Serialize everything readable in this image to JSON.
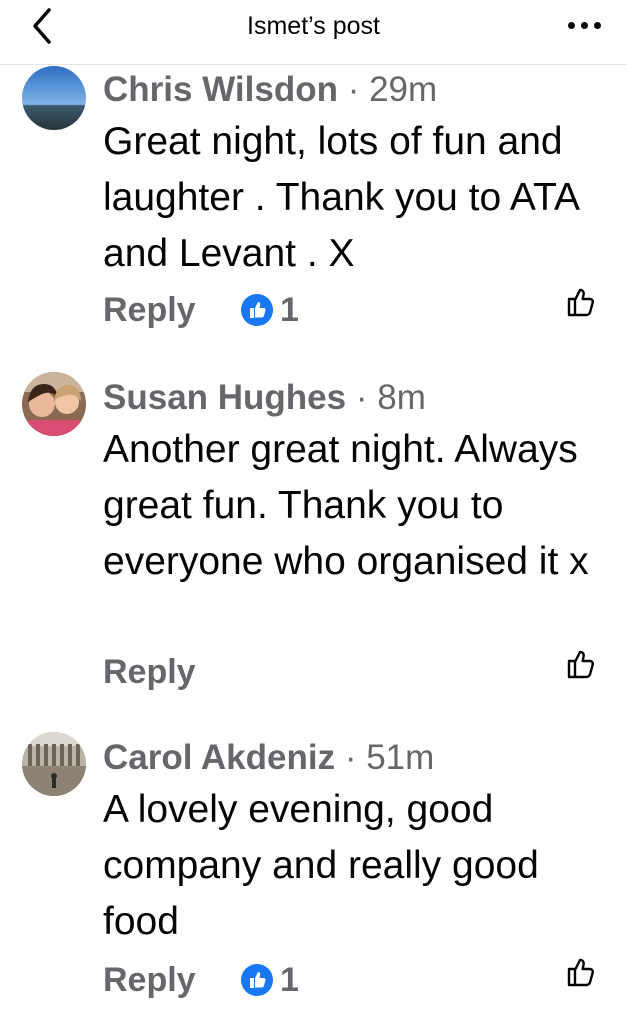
{
  "header": {
    "title": "Ismet’s post",
    "back_icon": "chevron-left-icon",
    "more_icon": "more-dots-icon"
  },
  "colors": {
    "text_primary": "#050505",
    "text_secondary": "#65676b",
    "like_blue": "#1877f2",
    "divider": "#e4e6eb"
  },
  "comments": [
    {
      "author": "Chris Wilsdon",
      "time": "29m",
      "text": "Great night, lots of fun and laughter . Thank you to ATA and Levant . X",
      "reply_label": "Reply",
      "reaction_count": "1"
    },
    {
      "author": "Susan Hughes",
      "time": "8m",
      "text": "Another great night. Always great fun. Thank you to everyone who organised it x",
      "reply_label": "Reply",
      "reaction_count": null
    },
    {
      "author": "Carol Akdeniz",
      "time": "51m",
      "text": "A lovely evening, good company and really good food",
      "reply_label": "Reply",
      "reaction_count": "1"
    }
  ],
  "separator": "·"
}
